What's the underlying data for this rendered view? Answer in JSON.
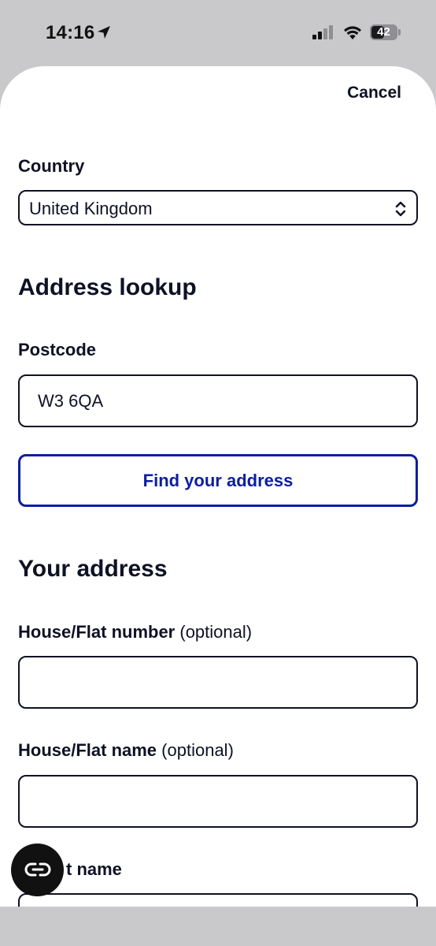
{
  "status_bar": {
    "time": "14:16",
    "battery": "42",
    "icons": [
      "location-arrow-icon",
      "cellular-signal-icon",
      "wifi-icon",
      "battery-icon"
    ]
  },
  "sheet": {
    "cancel_label": "Cancel",
    "country": {
      "label": "Country",
      "selected_value": "United Kingdom"
    },
    "address_lookup": {
      "heading": "Address lookup",
      "postcode_label": "Postcode",
      "postcode_value": "W3 6QA",
      "find_button_label": "Find your address"
    },
    "your_address": {
      "heading": "Your address",
      "house_number_label": "House/Flat number",
      "house_number_optional": "(optional)",
      "house_number_value": "",
      "house_name_label": "House/Flat name",
      "house_name_optional": "(optional)",
      "house_name_value": "",
      "street_label_partial": "t name",
      "street_value": ""
    }
  },
  "fab": {
    "icon": "link-icon"
  },
  "colors": {
    "text": "#0f1124",
    "accent_blue": "#0d1e9e",
    "status_bar_bg": "#c9c9cb",
    "sheet_bg": "#ffffff"
  }
}
